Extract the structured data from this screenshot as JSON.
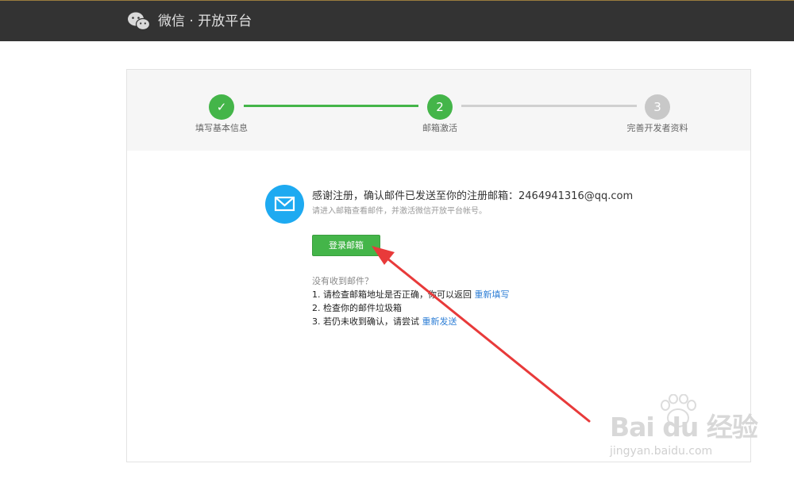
{
  "header": {
    "brand": "微信 · 开放平台",
    "logo_icon": "wechat-icon"
  },
  "steps": [
    {
      "marker": "✓",
      "label": "填写基本信息",
      "status": "done"
    },
    {
      "marker": "2",
      "label": "邮箱激活",
      "status": "current"
    },
    {
      "marker": "3",
      "label": "完善开发者资料",
      "status": "pending"
    }
  ],
  "message": {
    "icon": "mail-icon",
    "title": "感谢注册，确认邮件已发送至你的注册邮箱：2464941316@qq.com",
    "subtitle": "请进入邮箱查看邮件，并激活微信开放平台帐号。",
    "button_label": "登录邮箱"
  },
  "help": {
    "question": "没有收到邮件？",
    "item1_text": "1. 请检查邮箱地址是否正确，你可以返回 ",
    "item1_link": "重新填写",
    "item2_text": "2. 检查你的邮件垃圾箱",
    "item3_text": "3. 若仍未收到确认，请尝试 ",
    "item3_link": "重新发送"
  },
  "watermark": {
    "text": "Bai du 经验",
    "url": "jingyan.baidu.com"
  },
  "colors": {
    "topbar": "#333333",
    "accent_green": "#44b549",
    "mail_blue": "#1eaaf1",
    "link_blue": "#2f7fd6",
    "arrow_red": "#e83a3a"
  }
}
